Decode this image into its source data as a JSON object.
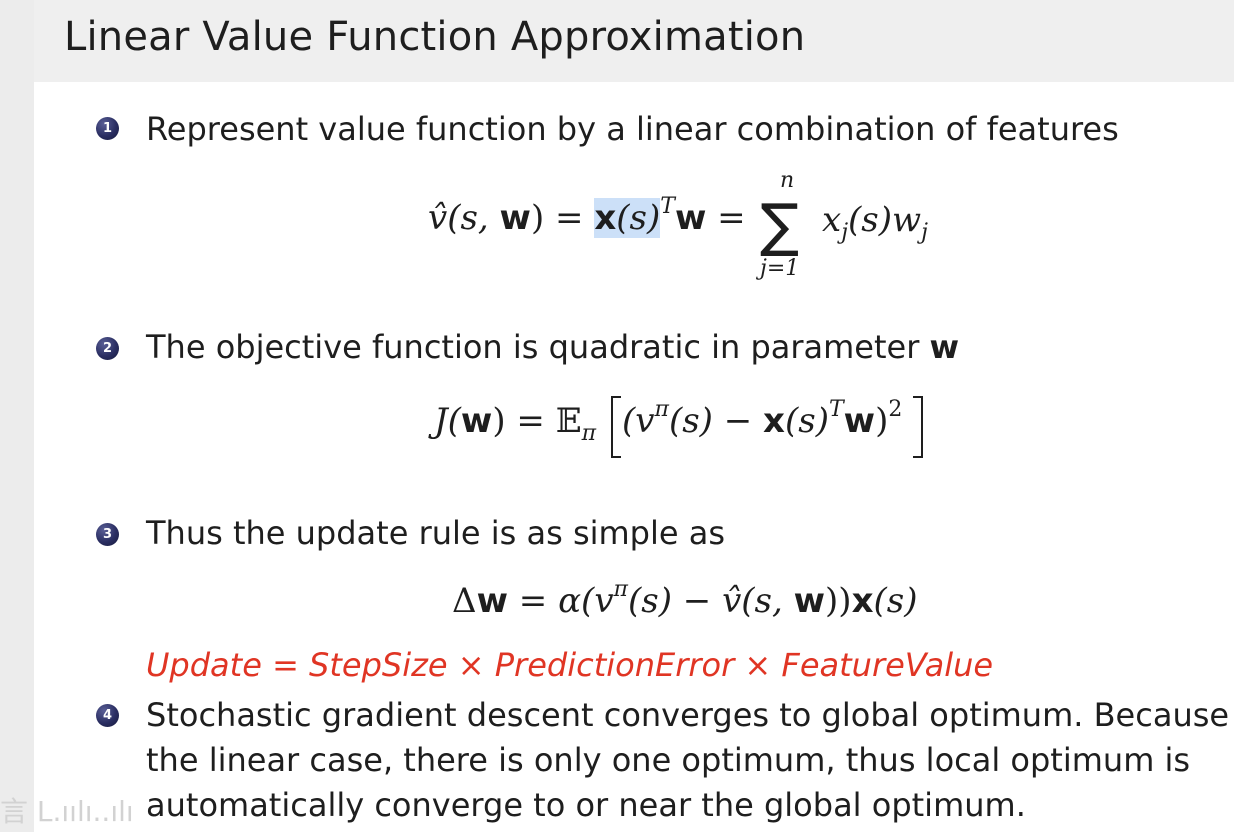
{
  "slide": {
    "title": "Linear Value Function Approximation",
    "watermark": "言 L.ıılı..ılı"
  },
  "items": [
    {
      "number": "1",
      "text": "Represent value function by a linear combination of features"
    },
    {
      "number": "2",
      "text": "The objective function is quadratic in parameter",
      "bold_tail": "w"
    },
    {
      "number": "3",
      "text": "Thus the update rule is as simple as"
    },
    {
      "number": "4",
      "lines": [
        "Stochastic gradient descent converges to global optimum. Because in",
        "the linear case, there is only one optimum, thus local optimum is",
        "automatically converge to or near the global optimum."
      ]
    }
  ],
  "formulas": {
    "f1": {
      "lhs": "v̂(s, ",
      "w": "w",
      "rhs_close": ") = ",
      "x": "x",
      "xs": "(s)",
      "T": "T",
      "w2": "w",
      "eq2": " = ",
      "sum_top": "n",
      "sum_bottom": "j=1",
      "sum": "∑",
      "tail_x": "x",
      "tail_j": "j",
      "tail_s": "(s)",
      "tail_w": "w",
      "tail_j2": "j"
    },
    "f2": {
      "J": "J(",
      "w": "w",
      "eq": ") = ",
      "E": "𝔼",
      "pi": "π",
      "open": "(v",
      "pisup": "π",
      "s": "(s) − ",
      "x": "x",
      "xs": "(s)",
      "T": "T",
      "w2": "w",
      "close": ")",
      "sq": "2"
    },
    "f3": {
      "delta": "Δ",
      "w": "w",
      "eq": " = α(v",
      "pisup": "π",
      "mid": "(s) − v̂(s, ",
      "w2": "w",
      "close": "))",
      "x": "x",
      "xs": "(s)"
    },
    "f4": {
      "text": "Update = StepSize × PredictionError × FeatureValue"
    }
  }
}
